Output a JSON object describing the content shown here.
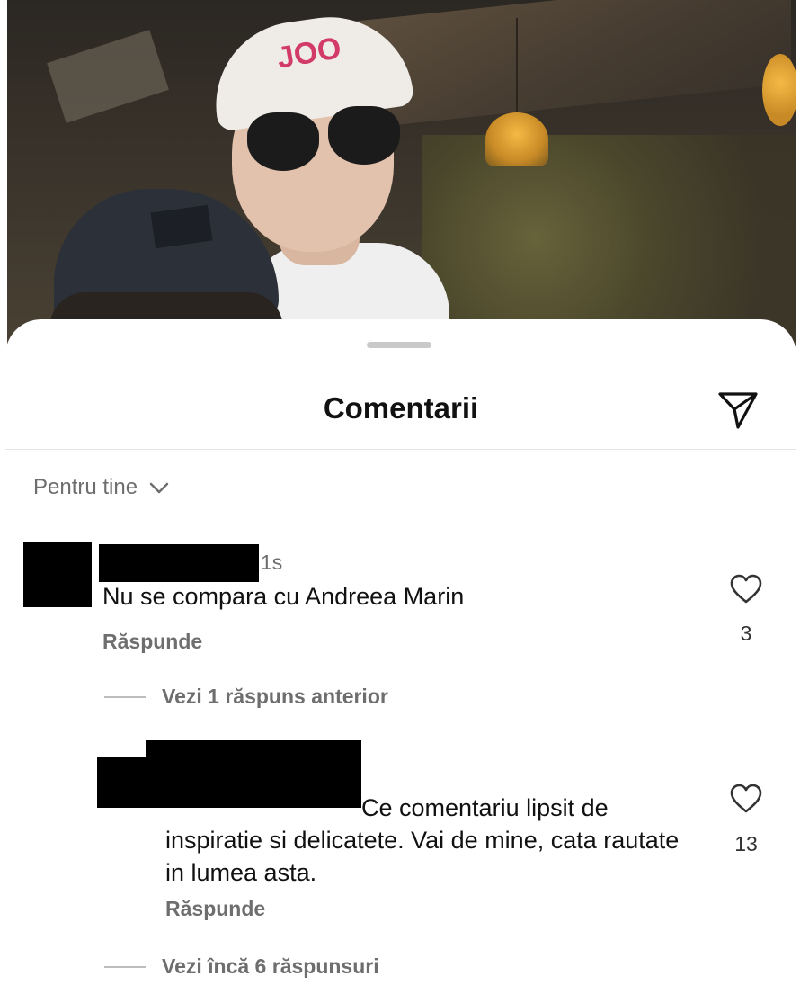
{
  "sheet": {
    "title": "Comentarii",
    "share_icon": "send-icon",
    "sort_label": "Pentru tine",
    "sort_icon": "chevron-down-icon"
  },
  "comments": [
    {
      "time": "1s",
      "text": "Nu se compara cu Andreea Marin",
      "reply_label": "Răspunde",
      "likes": "3",
      "thread_label": "Vezi 1 răspuns anterior"
    },
    {
      "text": "Ce comentariu lipsit de inspiratie si delicatete. Vai de mine, cata rautate in lumea asta.",
      "reply_label": "Răspunde",
      "likes": "13",
      "thread_label": "Vezi încă 6 răspunsuri"
    }
  ],
  "photo": {
    "cap_text": "JOO"
  },
  "colors": {
    "background": "#ffffff",
    "secondary_text": "#6e6e6e",
    "primary_text": "#111111"
  }
}
